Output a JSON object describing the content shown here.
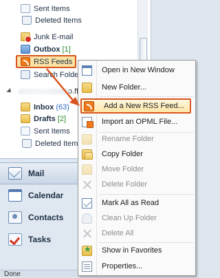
{
  "folders": [
    {
      "label": "Sent Items",
      "icon": "sent-items-icon",
      "count": ""
    },
    {
      "label": "Deleted Items",
      "icon": "deleted-items-icon",
      "count": ""
    },
    {
      "label": "Junk E-mail",
      "icon": "junk-email-icon",
      "count": ""
    },
    {
      "label": "Outbox",
      "icon": "outbox-icon",
      "count": "[1]"
    },
    {
      "label": "RSS Feeds",
      "icon": "rss-feed-icon",
      "count": ""
    },
    {
      "label": "Search Folde",
      "icon": "search-folder-icon",
      "count": ""
    }
  ],
  "account": {
    "tail": "o.ff"
  },
  "account_folders": [
    {
      "label": "Inbox",
      "icon": "inbox-icon",
      "count": "(63)"
    },
    {
      "label": "Drafts",
      "icon": "drafts-icon",
      "count": "[2]"
    },
    {
      "label": "Sent Items",
      "icon": "sent-items-icon",
      "count": ""
    },
    {
      "label": "Deleted Item",
      "icon": "deleted-items-icon",
      "count": ""
    }
  ],
  "nav_buttons": [
    {
      "label": "Mail",
      "icon": "mail-icon",
      "selected": true
    },
    {
      "label": "Calendar",
      "icon": "calendar-icon",
      "selected": false
    },
    {
      "label": "Contacts",
      "icon": "contacts-icon",
      "selected": false
    },
    {
      "label": "Tasks",
      "icon": "tasks-icon",
      "selected": false
    }
  ],
  "status": "Done",
  "context_menu": [
    {
      "label": "Open in New Window",
      "icon": "new-window-icon",
      "disabled": false
    },
    {
      "label": "New Folder...",
      "icon": "new-folder-icon",
      "disabled": false
    },
    {
      "label": "Add a New RSS Feed...",
      "icon": "rss-feed-icon",
      "disabled": false,
      "highlighted": true
    },
    {
      "label": "Import an OPML File...",
      "icon": "opml-import-icon",
      "disabled": false
    },
    {
      "label": "Rename Folder",
      "icon": "rename-folder-icon",
      "disabled": true
    },
    {
      "label": "Copy Folder",
      "icon": "copy-folder-icon",
      "disabled": false
    },
    {
      "label": "Move Folder",
      "icon": "move-folder-icon",
      "disabled": true
    },
    {
      "label": "Delete Folder",
      "icon": "delete-folder-icon",
      "disabled": true
    },
    {
      "label": "Mark All as Read",
      "icon": "mark-read-icon",
      "disabled": false
    },
    {
      "label": "Clean Up Folder",
      "icon": "clean-up-icon",
      "disabled": true
    },
    {
      "label": "Delete All",
      "icon": "delete-all-icon",
      "disabled": true
    },
    {
      "label": "Show in Favorites",
      "icon": "favorites-icon",
      "disabled": false
    },
    {
      "label": "Properties...",
      "icon": "properties-icon",
      "disabled": false
    }
  ],
  "colors": {
    "highlight_border": "#d9541e",
    "highlight_fill": "#fde6a6",
    "link_count": "#2a6bbf"
  }
}
